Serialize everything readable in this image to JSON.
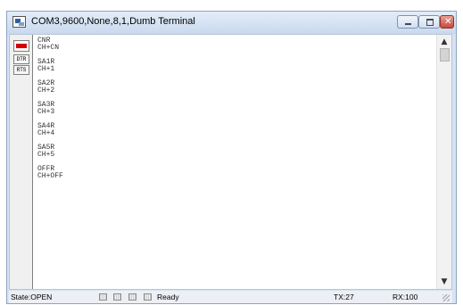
{
  "window": {
    "title": "COM3,9600,None,8,1,Dumb Terminal"
  },
  "left_panel": {
    "dtr_label": "DTR",
    "rts_label": "RTS"
  },
  "terminal": {
    "lines": [
      "CNR",
      "CH+CN",
      "",
      "SA1R",
      "CH+1",
      "",
      "SA2R",
      "CH+2",
      "",
      "SA3R",
      "CH+3",
      "",
      "SA4R",
      "CH+4",
      "",
      "SA5R",
      "CH+5",
      "",
      "OFFR",
      "CH+OFF"
    ]
  },
  "statusbar": {
    "state": "State:OPEN",
    "ready": "Ready",
    "tx": "TX:27",
    "rx": "RX:100"
  },
  "colors": {
    "led": "#d40000",
    "titlebar": "#c9d9ee",
    "close_button": "#c6493a"
  }
}
